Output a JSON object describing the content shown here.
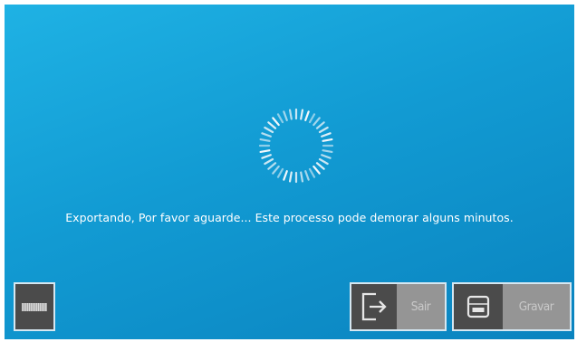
{
  "dialog": {
    "message": "Exportando, Por favor aguarde... Este processo pode demorar alguns minutos."
  },
  "buttons": {
    "exit_label": "Sair",
    "save_label": "Gravar"
  },
  "icons": {
    "spinner": "loading-spinner-icon",
    "exit": "exit-door-arrow-icon",
    "save": "floppy-disk-icon"
  },
  "colors": {
    "background_top": "#1fb2e4",
    "background_bottom": "#0a83bf",
    "button_dark": "#4b4b4b",
    "button_label_bg": "#959595",
    "button_label_text": "#c9c9c9"
  }
}
